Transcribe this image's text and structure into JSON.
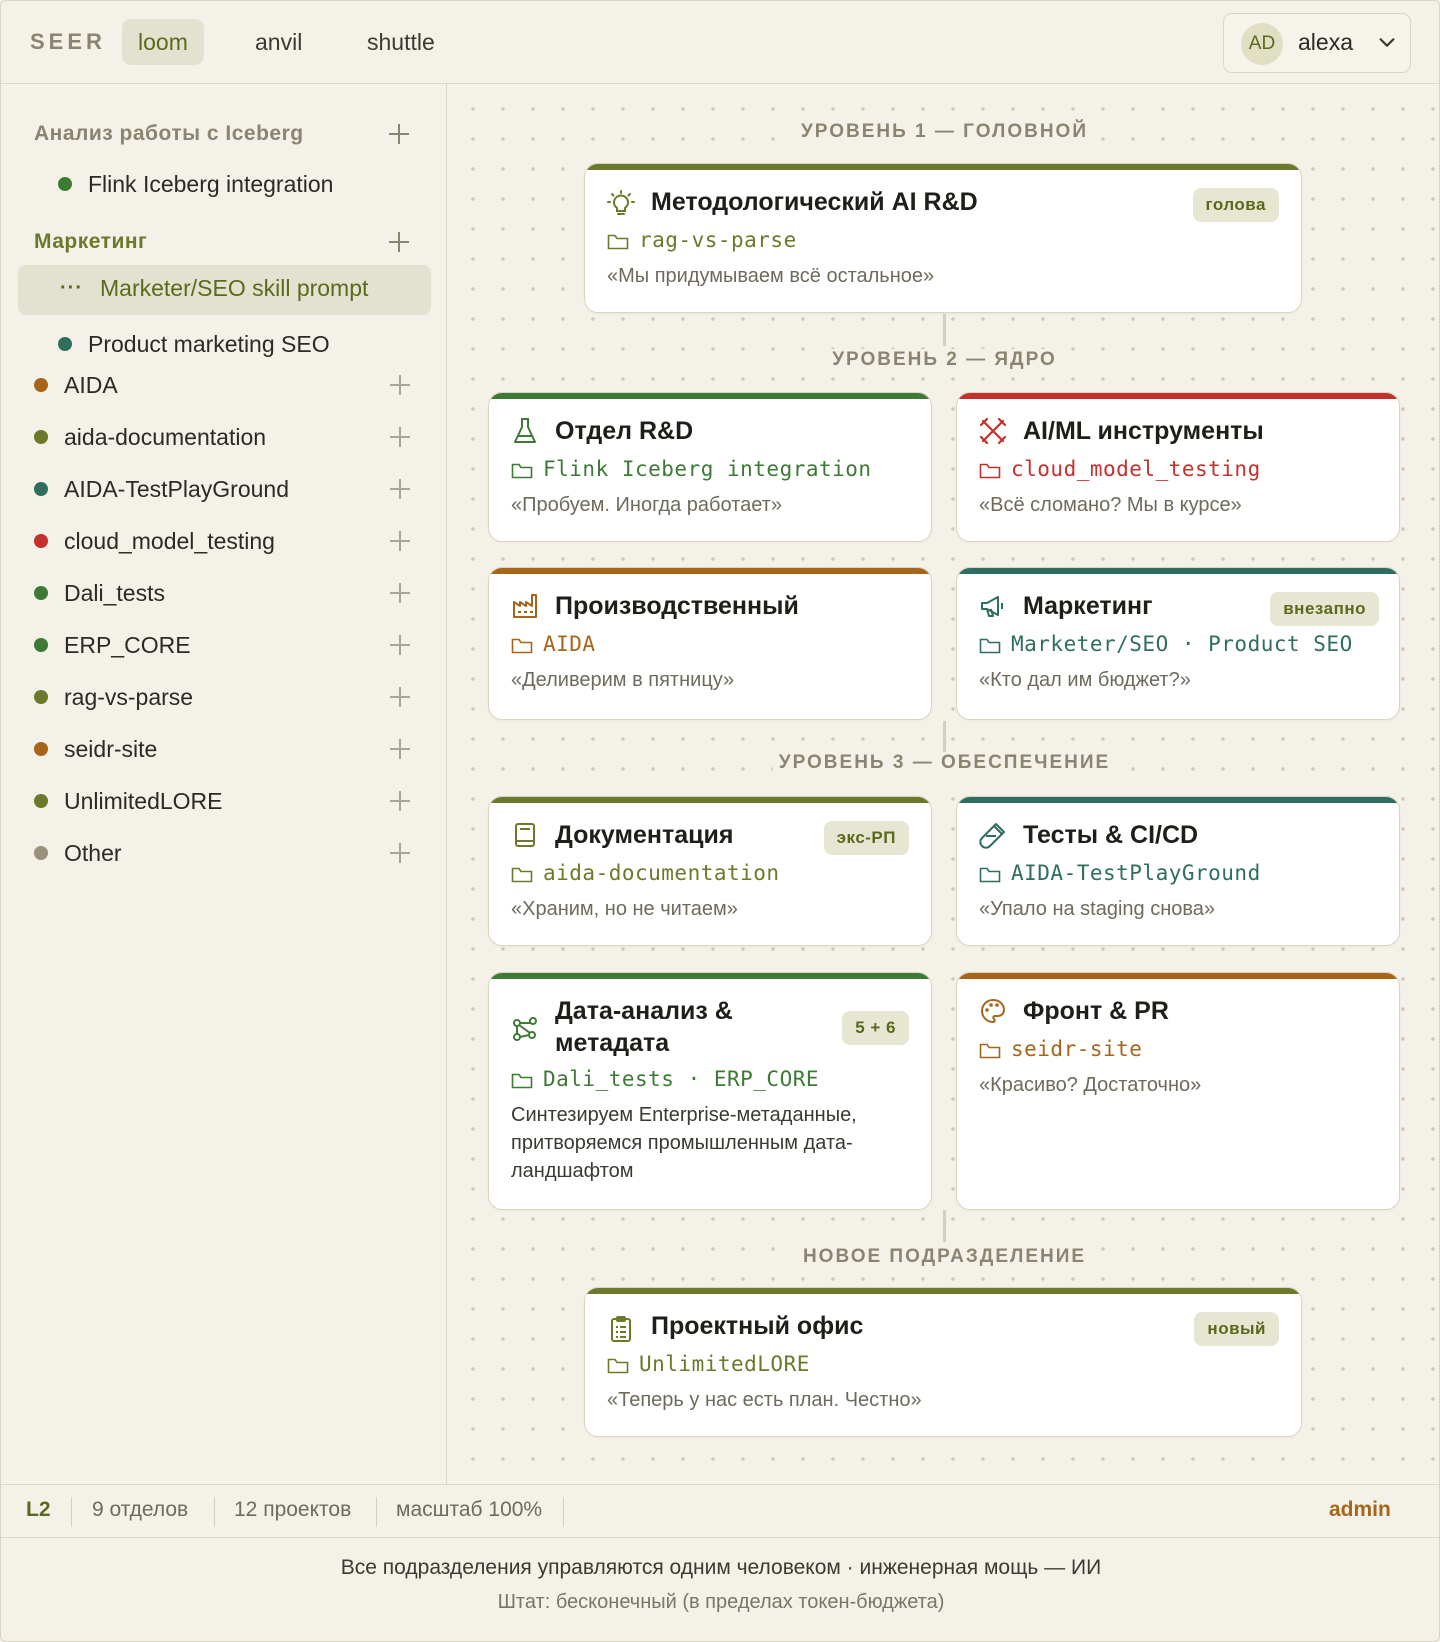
{
  "topbar": {
    "brand": "SEER",
    "tabs": [
      "loom",
      "anvil",
      "shuttle"
    ],
    "active_tab": "loom",
    "user_initials": "AD",
    "user_name": "alexa"
  },
  "sidebar": {
    "groups": [
      {
        "header": "Анализ работы с Iceberg",
        "items": [
          {
            "label": "Flink Iceberg integration",
            "color": "#3d7a35"
          }
        ]
      },
      {
        "header": "Маркетинг",
        "items": [
          {
            "label": "Marketer/SEO skill prompt",
            "selected": true,
            "icon": "ellipsis-icon"
          },
          {
            "label": "Product marketing SEO",
            "color": "#2f6e5e"
          }
        ]
      }
    ],
    "projects": [
      {
        "label": "AIDA",
        "color": "#a8651a"
      },
      {
        "label": "aida-documentation",
        "color": "#6b7a2a"
      },
      {
        "label": "AIDA-TestPlayGround",
        "color": "#2f6e5e"
      },
      {
        "label": "cloud_model_testing",
        "color": "#c4302b"
      },
      {
        "label": "Dali_tests",
        "color": "#3d7a35"
      },
      {
        "label": "ERP_CORE",
        "color": "#3d7a35"
      },
      {
        "label": "rag-vs-parse",
        "color": "#6b7a2a"
      },
      {
        "label": "seidr-site",
        "color": "#a8651a"
      },
      {
        "label": "UnlimitedLORE",
        "color": "#6b7a2a"
      },
      {
        "label": "Other",
        "color": "#9a917c"
      }
    ]
  },
  "canvas": {
    "levels": {
      "l1": "УРОВЕНЬ 1 — ГОЛОВНОЙ",
      "l2": "УРОВЕНЬ 2 — ЯДРО",
      "l3": "УРОВЕНЬ 3 — ОБЕСПЕЧЕНИЕ",
      "l4": "НОВОЕ ПОДРАЗДЕЛЕНИЕ"
    },
    "cards": {
      "head": {
        "title": "Методологический AI R&D",
        "project": "rag-vs-parse",
        "quote": "«Мы придумываем всё остальное»",
        "badge": "голова",
        "icon": "lightbulb-icon",
        "color": "#6b7a2a"
      },
      "rnd": {
        "title": "Отдел R&D",
        "project": "Flink Iceberg integration",
        "quote": "«Пробуем. Иногда работает»",
        "icon": "flask-icon",
        "color": "#3d7a35"
      },
      "aiml": {
        "title": "AI/ML инструменты",
        "project": "cloud_model_testing",
        "quote": "«Всё сломано? Мы в курсе»",
        "icon": "tools-icon",
        "color": "#c4302b"
      },
      "prod": {
        "title": "Производственный",
        "project": "AIDA",
        "quote": "«Деливерим в пятницу»",
        "icon": "factory-icon",
        "color": "#a8651a"
      },
      "mkt": {
        "title": "Маркетинг",
        "project": "Marketer/SEO · Product SEO",
        "quote": "«Кто дал им бюджет?»",
        "badge": "внезапно",
        "icon": "megaphone-icon",
        "color": "#2f6e5e"
      },
      "docs": {
        "title": "Документация",
        "project": "aida-documentation",
        "quote": "«Храним, но не читаем»",
        "badge": "экс-РП",
        "icon": "book-icon",
        "color": "#6b7a2a"
      },
      "tests": {
        "title": "Тесты & CI/CD",
        "project": "AIDA-TestPlayGround",
        "quote": "«Упало на staging снова»",
        "icon": "test-tube-icon",
        "color": "#2f6e5e"
      },
      "data": {
        "title_line1": "Дата-анализ &",
        "title_line2": "метадата",
        "project": "Dali_tests · ERP_CORE",
        "desc_line1": "Синтезируем Enterprise-метаданные,",
        "desc_line2": "притворяемся промышленным дата-",
        "desc_line3": "ландшафтом",
        "badge": "5 + 6",
        "icon": "graph-icon",
        "color": "#3d7a35"
      },
      "front": {
        "title": "Фронт & PR",
        "project": "seidr-site",
        "quote": "«Красиво? Достаточно»",
        "icon": "palette-icon",
        "color": "#a8651a"
      },
      "pmo": {
        "title": "Проектный офис",
        "project": "UnlimitedLORE",
        "quote": "«Теперь у нас есть план. Честно»",
        "badge": "новый",
        "icon": "clipboard-icon",
        "color": "#6b7a2a"
      }
    }
  },
  "statusbar": {
    "level": "L2",
    "departments": "9 отделов",
    "projects": "12 проектов",
    "zoom": "масштаб 100%",
    "role": "admin"
  },
  "footer": {
    "line1": "Все подразделения управляются одним человеком · инженерная мощь — ИИ",
    "line2": "Штат: бесконечный (в пределах токен-бюджета)"
  }
}
